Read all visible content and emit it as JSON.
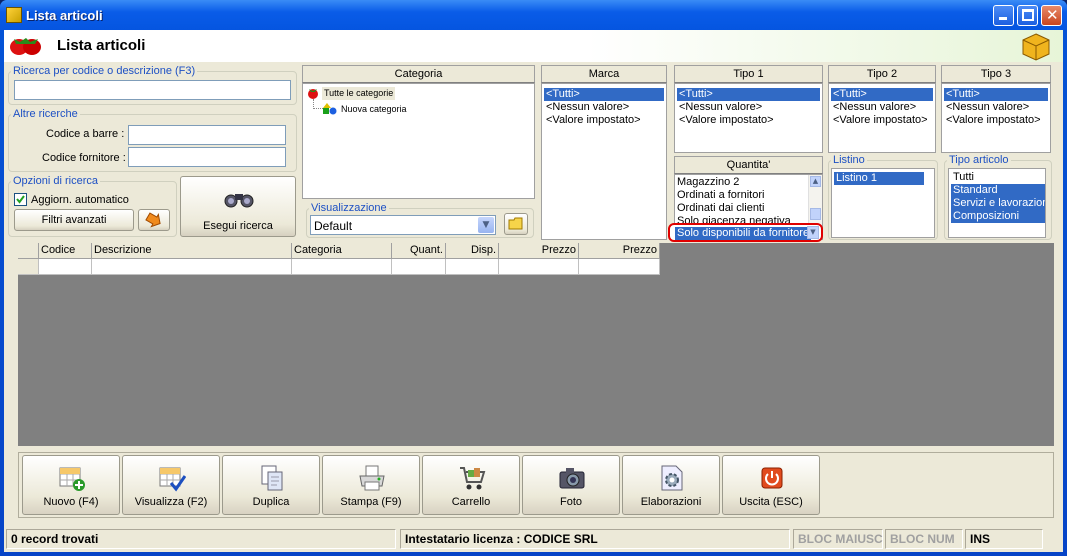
{
  "window": {
    "title": "Lista articoli"
  },
  "header": {
    "title": "Lista articoli"
  },
  "search": {
    "legend": "Ricerca per codice o descrizione (F3)",
    "value": ""
  },
  "altre": {
    "legend": "Altre ricerche",
    "barcode_label": "Codice a barre :",
    "supplier_label": "Codice fornitore :"
  },
  "options": {
    "legend": "Opzioni di ricerca",
    "auto_label": "Aggiorn. automatico",
    "auto_checked": true,
    "filters_button": "Filtri avanzati"
  },
  "search_button": "Esegui ricerca",
  "categoria": {
    "header": "Categoria",
    "items": [
      "Tutte le categorie",
      "Nuova categoria"
    ]
  },
  "visualizzazione": {
    "legend": "Visualizzazione",
    "selected": "Default"
  },
  "marca": {
    "header": "Marca",
    "items": [
      "<Tutti>",
      "<Nessun valore>",
      "<Valore impostato>"
    ],
    "selected": 0
  },
  "tipo1": {
    "header": "Tipo 1",
    "items": [
      "<Tutti>",
      "<Nessun valore>",
      "<Valore impostato>"
    ],
    "selected": 0
  },
  "tipo2": {
    "header": "Tipo 2",
    "items": [
      "<Tutti>",
      "<Nessun valore>",
      "<Valore impostato>"
    ],
    "selected": 0
  },
  "tipo3": {
    "header": "Tipo 3",
    "items": [
      "<Tutti>",
      "<Nessun valore>",
      "<Valore impostato>"
    ],
    "selected": 0
  },
  "quantita": {
    "header": "Quantita'",
    "items": [
      "Magazzino 2",
      "Ordinati a fornitori",
      "Ordinati dai clienti",
      "Solo giacenza negativa",
      "Solo disponibili da fornitore"
    ],
    "highlighted": "Solo disponibili da fornitore"
  },
  "listino": {
    "legend": "Listino",
    "items": [
      "Listino 1"
    ]
  },
  "tipo_articolo": {
    "legend": "Tipo articolo",
    "items": [
      "Tutti",
      "Standard",
      "Servizi e lavorazioni",
      "Composizioni"
    ]
  },
  "grid": {
    "columns": [
      "Codice",
      "Descrizione",
      "Categoria",
      "Quant.",
      "Disp.",
      "Prezzo",
      "Prezzo"
    ]
  },
  "toolbar": {
    "buttons": [
      {
        "label": "Nuovo (F4)",
        "icon": "new-item-icon"
      },
      {
        "label": "Visualizza (F2)",
        "icon": "view-item-icon"
      },
      {
        "label": "Duplica",
        "icon": "duplicate-icon"
      },
      {
        "label": "Stampa (F9)",
        "icon": "printer-icon"
      },
      {
        "label": "Carrello",
        "icon": "cart-icon"
      },
      {
        "label": "Foto",
        "icon": "camera-icon"
      },
      {
        "label": "Elaborazioni",
        "icon": "gear-icon"
      },
      {
        "label": "Uscita (ESC)",
        "icon": "power-icon"
      }
    ]
  },
  "status": {
    "records": "0 record trovati",
    "license": "Intestatario licenza : CODICE SRL",
    "caps": "BLOC MAIUSC",
    "num": "BLOC NUM",
    "ins": "INS"
  },
  "colors": {
    "selection": "#316ac5",
    "legend": "#1d50c4",
    "highlight_ring": "#e00000"
  }
}
